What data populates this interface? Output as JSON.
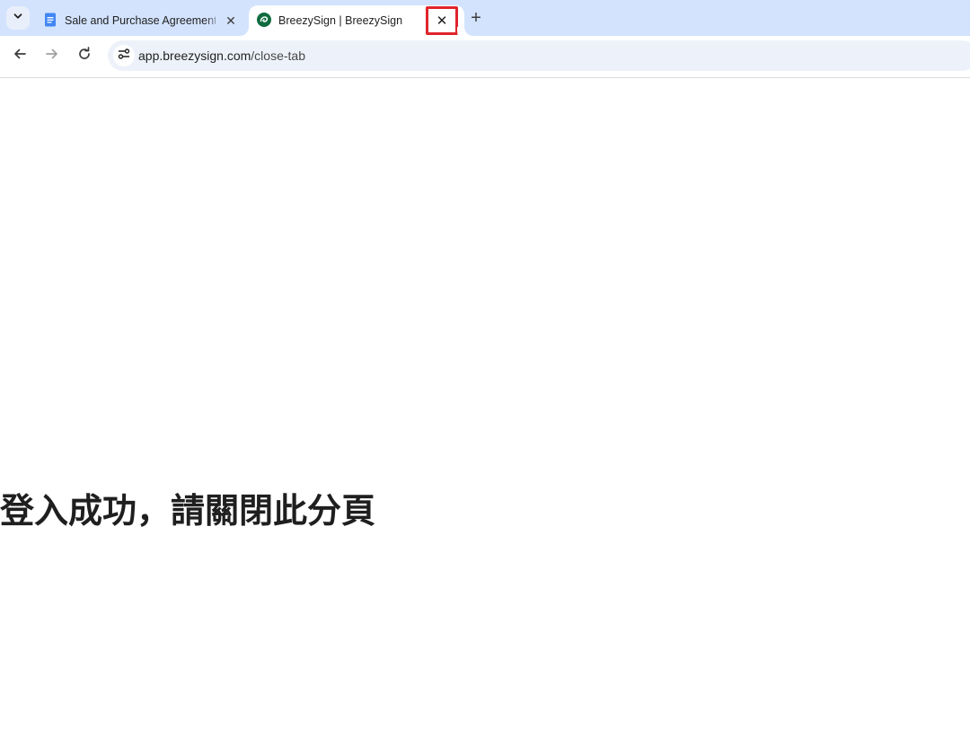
{
  "browser": {
    "tabs": [
      {
        "title": "Sale and Purchase Agreement",
        "icon": "google-docs-icon",
        "active": false
      },
      {
        "title": "BreezySign | BreezySign",
        "icon": "breezysign-logo-icon",
        "active": true
      }
    ],
    "close_glyph": "✕",
    "new_tab_glyph": "+",
    "url_host": "app.breezysign.com",
    "url_path": "/close-tab"
  },
  "page": {
    "heading": "登入成功，請關閉此分頁"
  },
  "colors": {
    "tabstrip_bg": "#d3e3fd",
    "omnibox_bg": "#edf2fa",
    "highlight_border": "#e0242b",
    "docs_blue": "#4285f4",
    "breezysign_green": "#0f6b3f"
  }
}
